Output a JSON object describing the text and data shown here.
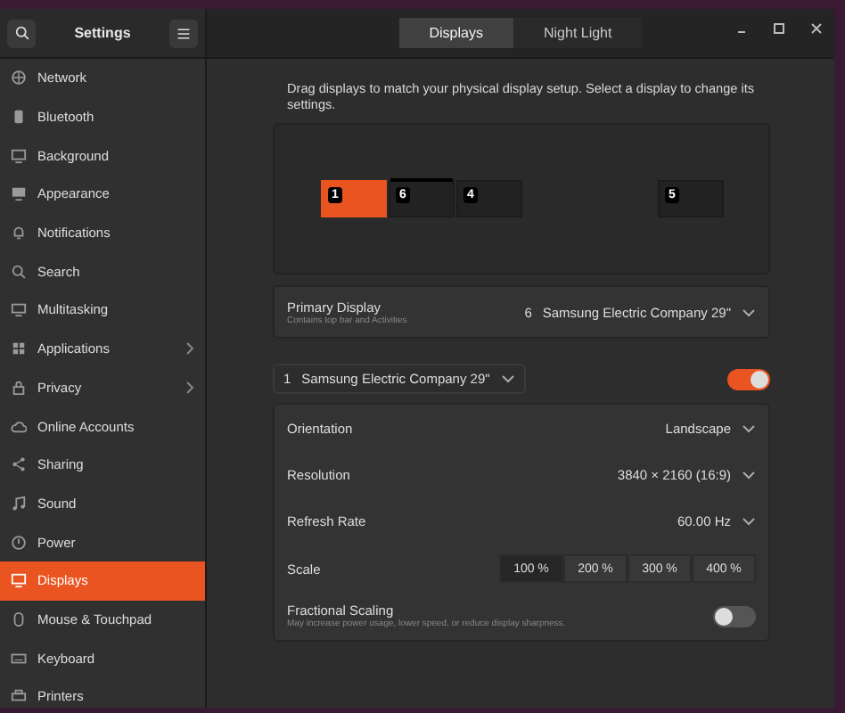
{
  "window": {
    "title": "Settings",
    "tabs": [
      {
        "label": "Displays",
        "selected": true
      },
      {
        "label": "Night Light",
        "selected": false
      }
    ]
  },
  "sidebar": {
    "items": [
      {
        "label": "Network",
        "selected": false,
        "expandable": false
      },
      {
        "label": "Bluetooth",
        "selected": false,
        "expandable": false
      },
      {
        "label": "Background",
        "selected": false,
        "expandable": false
      },
      {
        "label": "Appearance",
        "selected": false,
        "expandable": false
      },
      {
        "label": "Notifications",
        "selected": false,
        "expandable": false
      },
      {
        "label": "Search",
        "selected": false,
        "expandable": false
      },
      {
        "label": "Multitasking",
        "selected": false,
        "expandable": false
      },
      {
        "label": "Applications",
        "selected": false,
        "expandable": true
      },
      {
        "label": "Privacy",
        "selected": false,
        "expandable": true
      },
      {
        "label": "Online Accounts",
        "selected": false,
        "expandable": false
      },
      {
        "label": "Sharing",
        "selected": false,
        "expandable": false
      },
      {
        "label": "Sound",
        "selected": false,
        "expandable": false
      },
      {
        "label": "Power",
        "selected": false,
        "expandable": false
      },
      {
        "label": "Displays",
        "selected": true,
        "expandable": false
      },
      {
        "label": "Mouse & Touchpad",
        "selected": false,
        "expandable": false
      },
      {
        "label": "Keyboard",
        "selected": false,
        "expandable": false
      },
      {
        "label": "Printers",
        "selected": false,
        "expandable": false
      }
    ]
  },
  "content": {
    "description": "Drag displays to match your physical display setup. Select a display to change its settings.",
    "arrangement": {
      "displays": [
        {
          "number": "1",
          "selected": true,
          "primary": false
        },
        {
          "number": "6",
          "selected": false,
          "primary": true
        },
        {
          "number": "4",
          "selected": false,
          "primary": false
        },
        {
          "number": "5",
          "selected": false,
          "primary": false
        }
      ]
    },
    "primary_display": {
      "title": "Primary Display",
      "subtitle": "Contains top bar and Activities",
      "number": "6",
      "value": "Samsung Electric Company 29\""
    },
    "monitor_select": {
      "number": "1",
      "name": "Samsung Electric Company 29\""
    },
    "monitor_on": true,
    "settings": [
      {
        "kind": "dropdown",
        "label": "Orientation",
        "value": "Landscape"
      },
      {
        "kind": "dropdown",
        "label": "Resolution",
        "value": "3840 × 2160 (16:9)"
      },
      {
        "kind": "dropdown",
        "label": "Refresh Rate",
        "value": "60.00 Hz"
      },
      {
        "kind": "segmented",
        "label": "Scale",
        "options": [
          {
            "label": "100 %",
            "selected": true
          },
          {
            "label": "200 %",
            "selected": false
          },
          {
            "label": "300 %",
            "selected": false
          },
          {
            "label": "400 %",
            "selected": false
          }
        ]
      },
      {
        "kind": "switch",
        "label": "Fractional Scaling",
        "subtitle": "May increase power usage, lower speed, or reduce display sharpness.",
        "on": false
      }
    ]
  }
}
